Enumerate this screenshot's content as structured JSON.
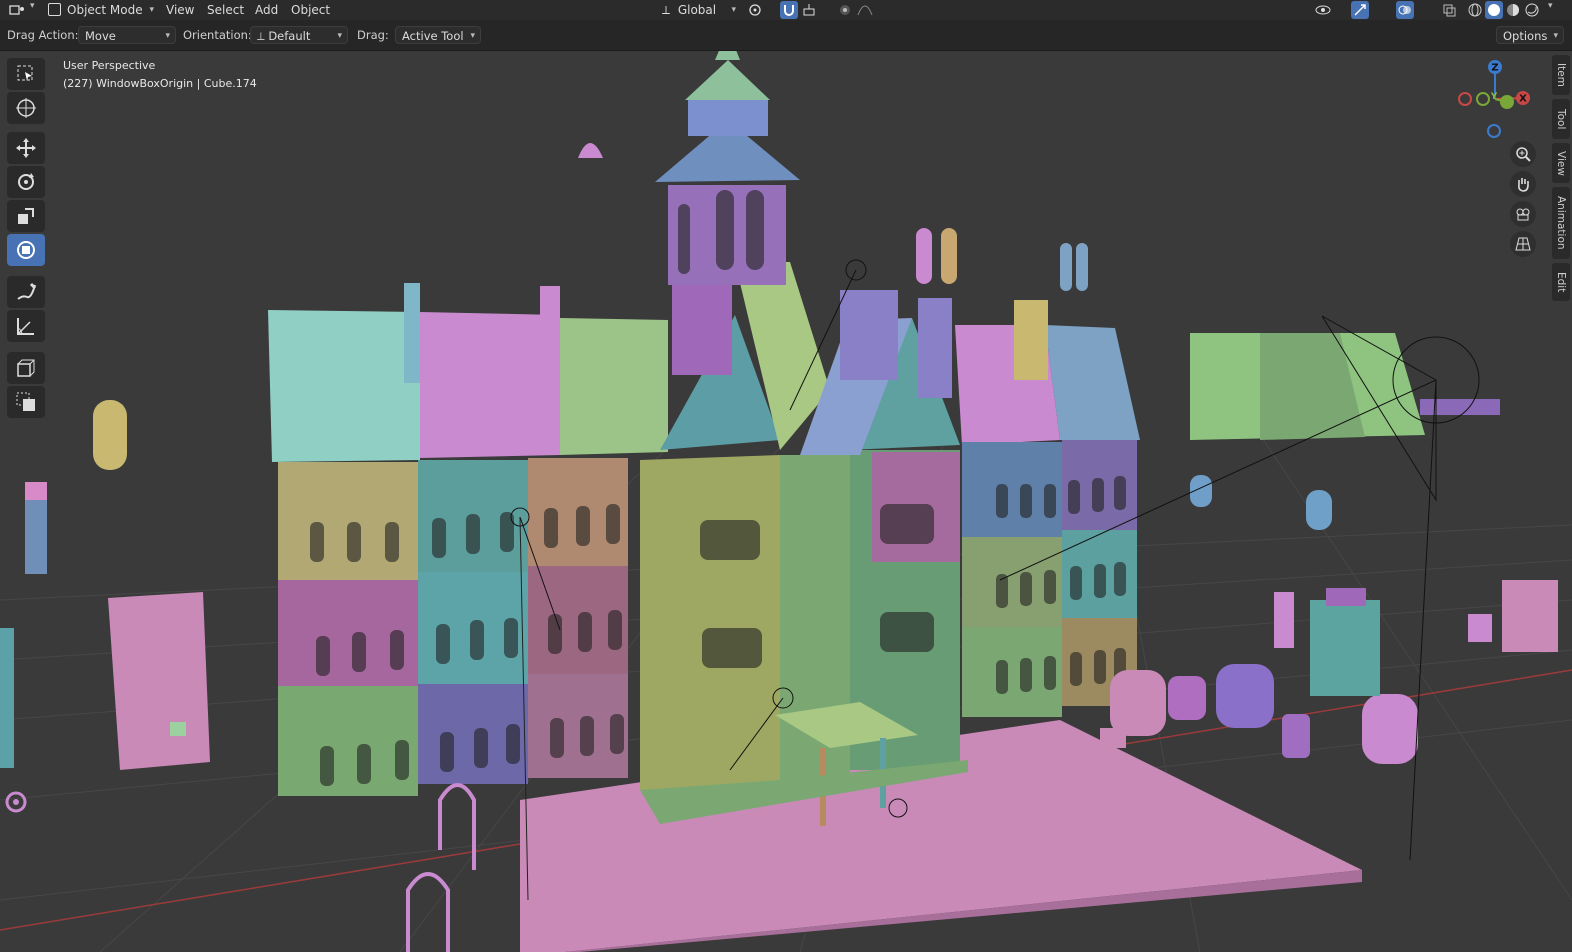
{
  "header": {
    "mode": "Object Mode",
    "menus": [
      "View",
      "Select",
      "Add",
      "Object"
    ],
    "transform_orientation": "Global"
  },
  "tool_settings": {
    "drag_action_label": "Drag Action:",
    "drag_action_value": "Move",
    "orientation_label": "Orientation:",
    "orientation_value": "Default",
    "drag_label": "Drag:",
    "drag_value": "Active Tool",
    "options_label": "Options"
  },
  "viewport": {
    "perspective": "User Perspective",
    "active_object": "(227) WindowBoxOrigin | Cube.174"
  },
  "gizmo": {
    "z": "Z",
    "y": "Y",
    "x": "X"
  },
  "sidebar_tabs": [
    "Item",
    "Tool",
    "View",
    "Animation",
    "Edit"
  ],
  "toolbar_icons": [
    "select-box-icon",
    "cursor-icon",
    "move-icon",
    "rotate-icon",
    "scale-icon",
    "transform-icon",
    "annotate-icon",
    "measure-icon",
    "add-cube-icon",
    "scale-cage-icon"
  ],
  "colors": {
    "accent": "#4772b3",
    "grid_x": "#9b3a3a",
    "viewport_bg": "#3a3a3a"
  }
}
